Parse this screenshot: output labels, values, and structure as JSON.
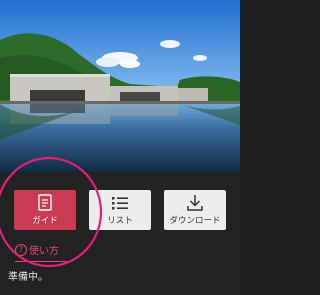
{
  "buttons": {
    "guide": {
      "label": "ガイド",
      "icon": "document-icon"
    },
    "list": {
      "label": "リスト",
      "icon": "list-icon"
    },
    "download": {
      "label": "ダウンロード",
      "icon": "download-icon"
    }
  },
  "help": {
    "icon": "question-circle-icon",
    "qmark": "?",
    "label": "使い方"
  },
  "status": {
    "text": "準備中。"
  },
  "colors": {
    "accent": "#c93a55",
    "background": "#222222",
    "highlight_circle": "#e0207a"
  }
}
